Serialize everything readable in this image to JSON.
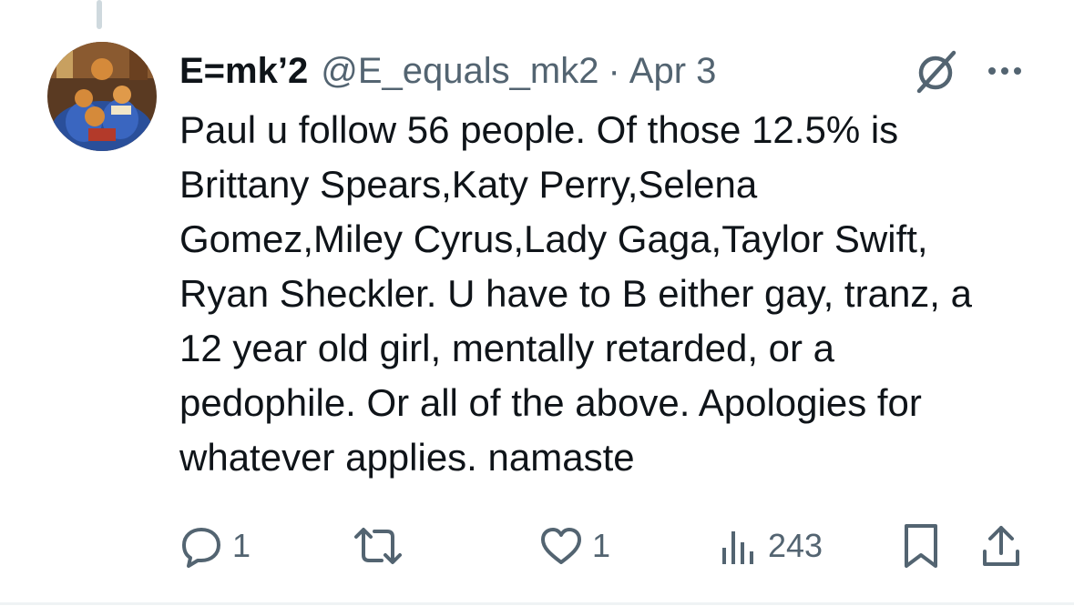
{
  "tweet": {
    "display_name": "E=mk’2",
    "handle": "@E_equals_mk2",
    "separator": "·",
    "date": "Apr 3",
    "text_lines": [
      "Paul u follow 56 people. Of those 12.5% is",
      "Brittany Spears,Katy Perry,Selena",
      "Gomez,Miley Cyrus,Lady Gaga,Taylor Swift,",
      "Ryan Sheckler. U have to B either gay, tranz, a",
      "12 year old girl, mentally retarded, or a",
      "pedophile. Or all of the above. Apologies for",
      "whatever applies. namaste"
    ]
  },
  "actions": {
    "replies": "1",
    "reposts": "",
    "likes": "1",
    "views": "243"
  },
  "icons": {
    "header": [
      "grok-icon",
      "more-icon"
    ],
    "actions": [
      "reply-icon",
      "repost-icon",
      "like-icon",
      "views-icon",
      "bookmark-icon",
      "share-icon"
    ]
  },
  "colors": {
    "text": "#0f1419",
    "secondary": "#536471",
    "thread_line": "#cfd9de",
    "divider": "#eff3f4"
  }
}
